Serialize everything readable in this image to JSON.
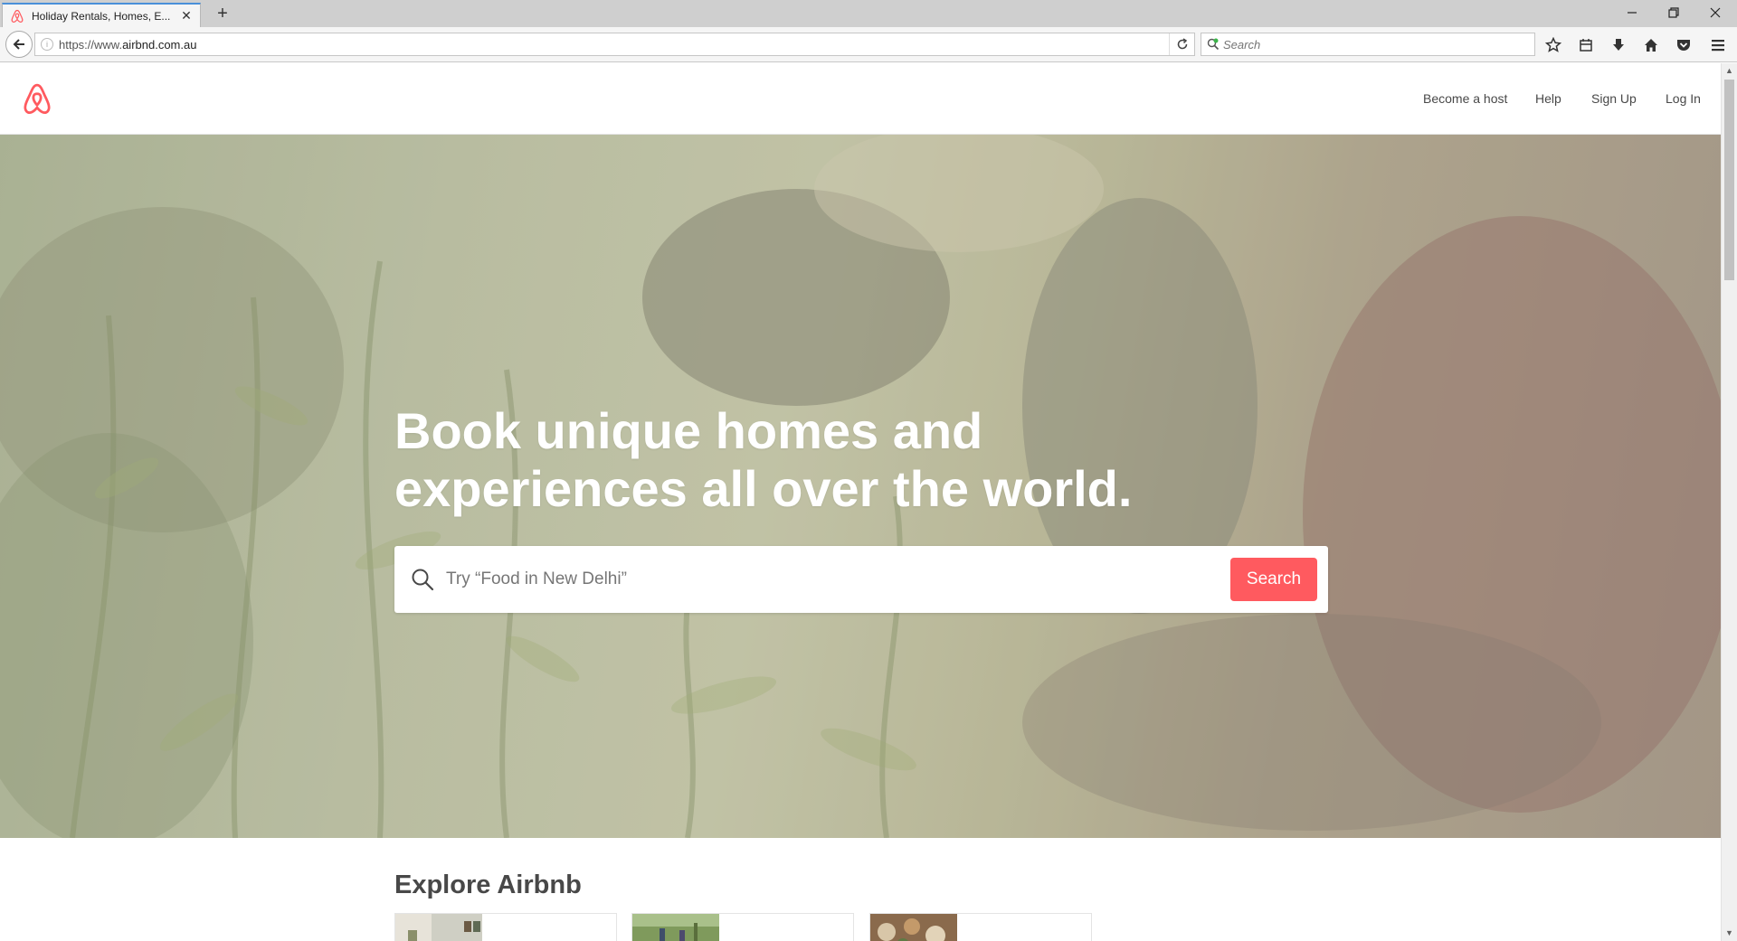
{
  "browser": {
    "tab_title": "Holiday Rentals, Homes, E...",
    "url_prefix": "https://www.",
    "url_domain": "airbnd.com.au",
    "search_placeholder": "Search"
  },
  "header": {
    "nav": {
      "become_host": "Become a host",
      "help": "Help",
      "sign_up": "Sign Up",
      "log_in": "Log In"
    }
  },
  "hero": {
    "title_line1": "Book unique homes and",
    "title_line2": "experiences all over the world.",
    "search_placeholder": "Try “Food in New Delhi”",
    "search_button": "Search"
  },
  "explore": {
    "title": "Explore Airbnb"
  },
  "colors": {
    "brand": "#ff5a5f",
    "text": "#484848"
  }
}
